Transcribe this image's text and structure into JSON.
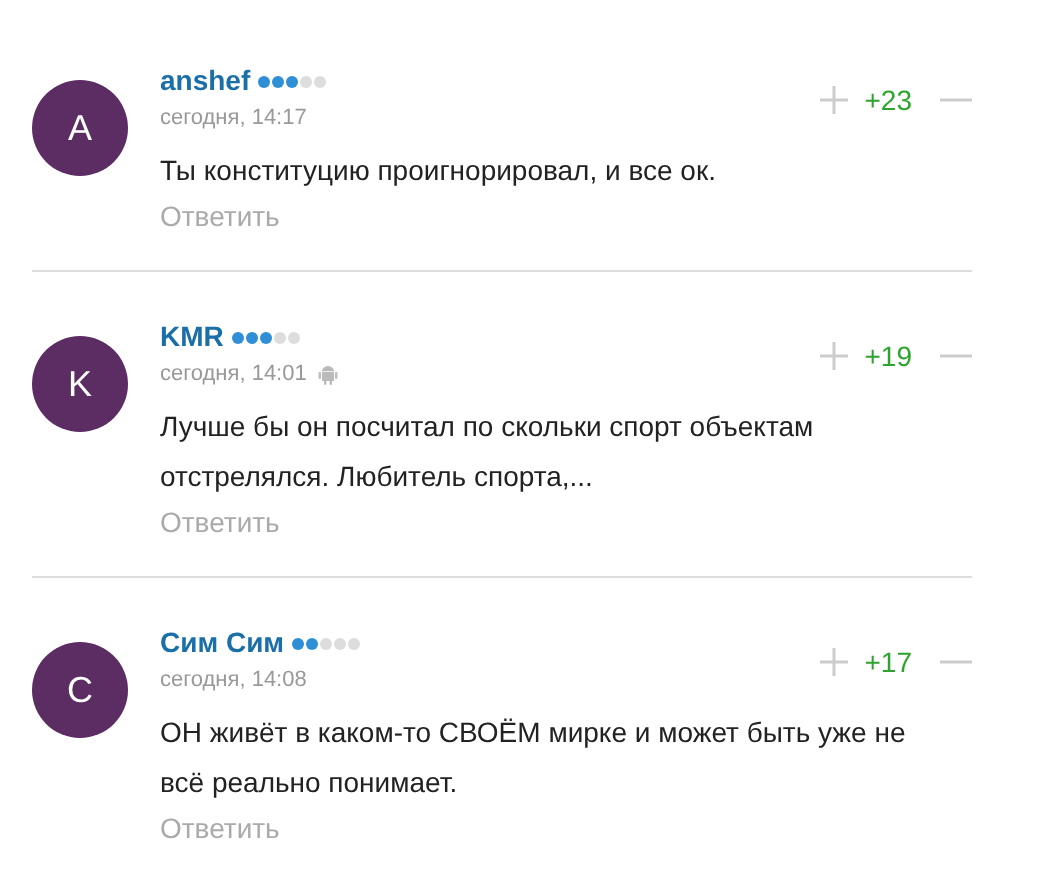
{
  "comments": [
    {
      "avatar_letter": "A",
      "author": "anshef",
      "stars": 3,
      "time": "сегодня, 14:17",
      "mobile": false,
      "score": "+23",
      "text": "Ты конституцию проигнорировал, и все ок.",
      "reply": "Ответить"
    },
    {
      "avatar_letter": "K",
      "author": "KMR",
      "stars": 3,
      "time": "сегодня, 14:01",
      "mobile": true,
      "score": "+19",
      "text": "Лучше бы он посчитал по скольки спорт объектам отстрелялся. Любитель спорта,...",
      "reply": "Ответить"
    },
    {
      "avatar_letter": "С",
      "author": "Сим Сим",
      "stars": 2,
      "time": "сегодня, 14:08",
      "mobile": false,
      "score": "+17",
      "text": "ОН живёт в каком-то СВОЁМ мирке и может быть уже не всё реально понимает.",
      "reply": "Ответить"
    }
  ]
}
